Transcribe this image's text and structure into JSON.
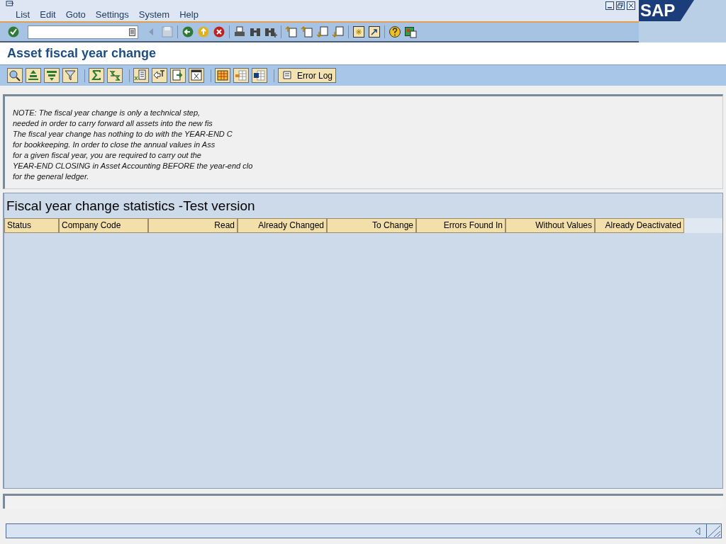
{
  "menu": [
    "List",
    "Edit",
    "Goto",
    "Settings",
    "System",
    "Help"
  ],
  "logo": "SAP",
  "title": "Asset fiscal year change",
  "error_log_button": "Error Log",
  "note_lines": [
    "NOTE: The fiscal year change is only a technical step,",
    "needed in order to carry forward all assets into the new fis",
    "The fiscal year change has nothing to do with the YEAR-END C",
    "for bookkeeping. In order to close the annual values in Ass",
    "for a given fiscal year, you are required to carry out the",
    "YEAR-END CLOSING in Asset Accounting BEFORE the year-end clo",
    "for the general ledger."
  ],
  "report": {
    "title": "Fiscal year change statistics -Test version",
    "columns": [
      "Status",
      "Company Code",
      "Read",
      "Already Changed",
      "To Change",
      "Errors Found In",
      "Without Values",
      "Already Deactivated"
    ]
  }
}
